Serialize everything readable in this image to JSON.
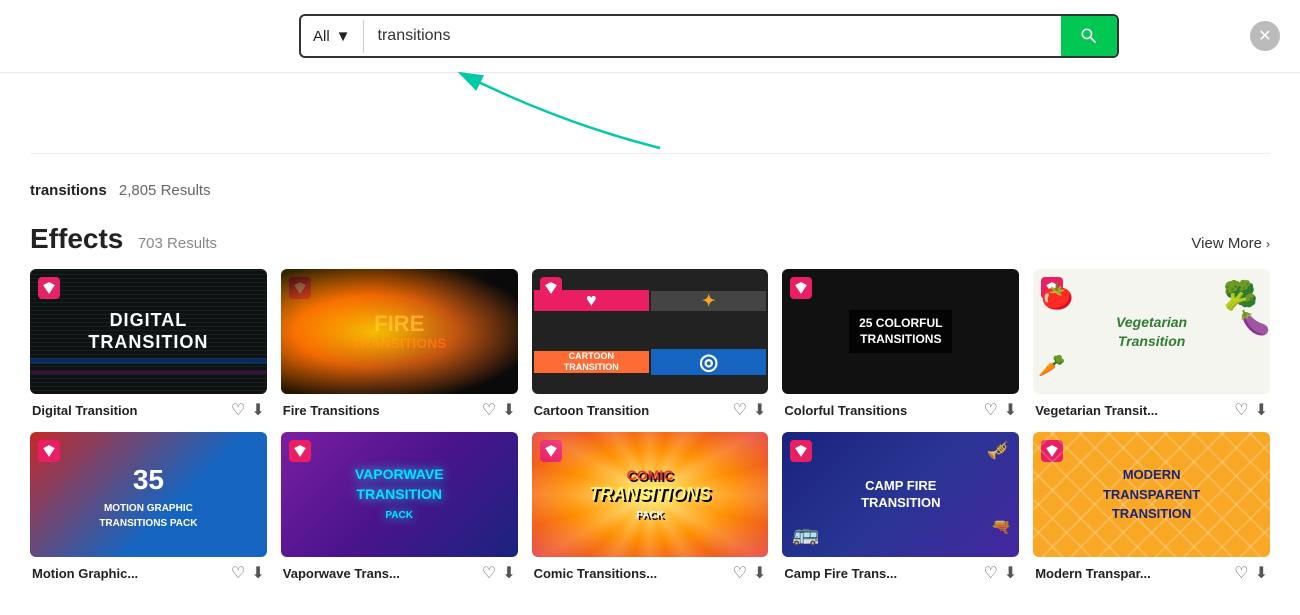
{
  "header": {
    "dropdown_label": "All",
    "search_value": "transitions",
    "search_placeholder": "transitions",
    "close_icon": "×"
  },
  "results_summary": {
    "query": "transitions",
    "count": "2,805 Results"
  },
  "effects_section": {
    "title": "Effects",
    "count": "703 Results",
    "view_more": "View More"
  },
  "row1": [
    {
      "id": "digital-transition",
      "label": "Digital Transition",
      "thumb_type": "digital",
      "thumb_text1": "DIGITAL",
      "thumb_text2": "TRANSITION"
    },
    {
      "id": "fire-transitions",
      "label": "Fire Transitions",
      "thumb_type": "fire",
      "thumb_text1": "FIRE",
      "thumb_text2": "TRANSITIONS"
    },
    {
      "id": "cartoon-transition",
      "label": "Cartoon Transition",
      "thumb_type": "cartoon",
      "thumb_text1": "CARTOON",
      "thumb_text2": "TRANSITION"
    },
    {
      "id": "colorful-transitions",
      "label": "Colorful Transitions",
      "thumb_type": "colorful",
      "thumb_text1": "25 COLORFUL",
      "thumb_text2": "TRANSITIONS"
    },
    {
      "id": "vegetarian-transition",
      "label": "Vegetarian Transit...",
      "thumb_type": "vegetarian",
      "thumb_text1": "Vegetarian",
      "thumb_text2": "Transition"
    }
  ],
  "row2": [
    {
      "id": "motion-pack",
      "label": "Motion Graphic...",
      "thumb_type": "motion",
      "thumb_text1": "35",
      "thumb_text2": "MOTION GRAPHIC TRANSITIONS PACK"
    },
    {
      "id": "vaporwave-transition",
      "label": "Vaporwave Trans...",
      "thumb_type": "vaporwave",
      "thumb_text1": "VAPORWAVE",
      "thumb_text2": "TRANSITION",
      "thumb_text3": "PACK"
    },
    {
      "id": "comic-transitions",
      "label": "Comic Transitions...",
      "thumb_type": "comic",
      "thumb_text1": "COMIC",
      "thumb_text2": "Transitions",
      "thumb_text3": "PACK"
    },
    {
      "id": "camp-fire-transition",
      "label": "Camp Fire Trans...",
      "thumb_type": "campfire",
      "thumb_text1": "CAMP FIRE",
      "thumb_text2": "TRANSITION"
    },
    {
      "id": "modern-transparent",
      "label": "Modern Transpar...",
      "thumb_type": "modern",
      "thumb_text1": "MODERN",
      "thumb_text2": "TRANSPARENT",
      "thumb_text3": "TRANSITION"
    }
  ]
}
